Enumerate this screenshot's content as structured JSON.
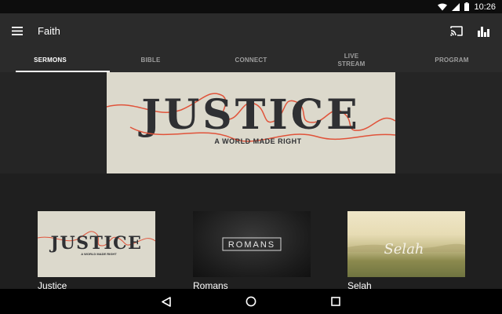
{
  "status_bar": {
    "time": "10:26",
    "icons": [
      "wifi-icon",
      "signal-icon",
      "battery-icon"
    ]
  },
  "app_bar": {
    "title": "Faith",
    "icons": [
      "menu-icon",
      "cast-icon",
      "equalizer-icon"
    ]
  },
  "tabs": [
    {
      "label": "SERMONS",
      "active": true
    },
    {
      "label": "BIBLE",
      "active": false
    },
    {
      "label": "CONNECT",
      "active": false
    },
    {
      "label": "LIVE\nSTREAM",
      "active": false
    },
    {
      "label": "PROGRAM",
      "active": false
    }
  ],
  "hero": {
    "title": "JUSTICE",
    "subtitle": "A WORLD MADE RIGHT"
  },
  "series": [
    {
      "label": "Justice",
      "art_title": "JUSTICE",
      "art_subtitle": "A WORLD MADE RIGHT"
    },
    {
      "label": "Romans",
      "art_title": "ROMANS"
    },
    {
      "label": "Selah",
      "art_title": "Selah"
    }
  ],
  "nav_bar": {
    "icons": [
      "back-icon",
      "home-icon",
      "recents-icon"
    ]
  },
  "colors": {
    "accent_red": "#e0533a",
    "card_cream": "#dcd9cc",
    "text_dark": "#2f3033"
  }
}
